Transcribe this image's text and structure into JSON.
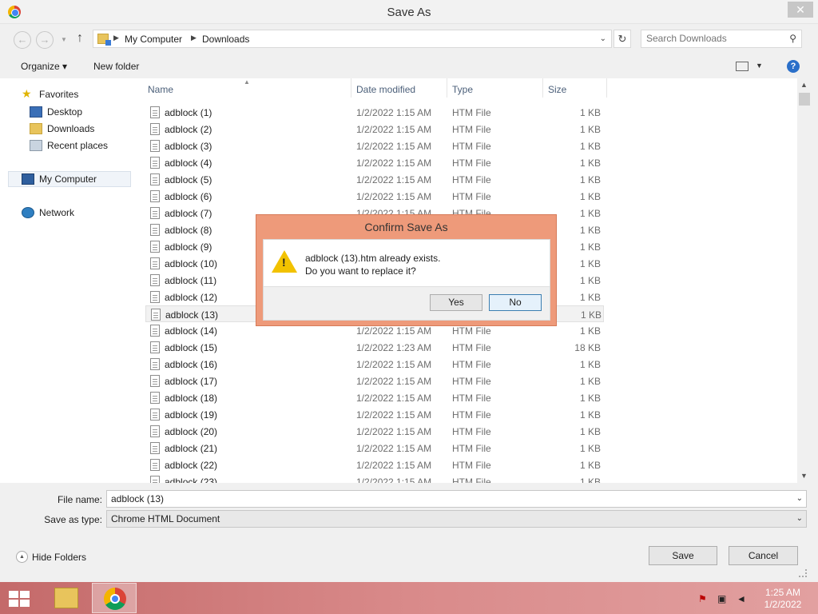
{
  "window": {
    "title": "Save As",
    "close_label": "✕"
  },
  "nav": {
    "back_glyph": "←",
    "forward_glyph": "→",
    "up_glyph": "↑",
    "breadcrumbs": [
      "My Computer",
      "Downloads"
    ],
    "refresh_glyph": "↻",
    "search_placeholder": "Search Downloads"
  },
  "toolbar": {
    "organize": "Organize ▾",
    "new_folder": "New folder",
    "help": "?"
  },
  "sidebar": {
    "favorites": "Favorites",
    "desktop": "Desktop",
    "downloads": "Downloads",
    "recent": "Recent places",
    "my_computer": "My Computer",
    "network": "Network"
  },
  "columns": {
    "name": "Name",
    "date": "Date modified",
    "type": "Type",
    "size": "Size"
  },
  "files": [
    {
      "name": "adblock (1)",
      "date": "1/2/2022 1:15 AM",
      "type": "HTM File",
      "size": "1 KB"
    },
    {
      "name": "adblock (2)",
      "date": "1/2/2022 1:15 AM",
      "type": "HTM File",
      "size": "1 KB"
    },
    {
      "name": "adblock (3)",
      "date": "1/2/2022 1:15 AM",
      "type": "HTM File",
      "size": "1 KB"
    },
    {
      "name": "adblock (4)",
      "date": "1/2/2022 1:15 AM",
      "type": "HTM File",
      "size": "1 KB"
    },
    {
      "name": "adblock (5)",
      "date": "1/2/2022 1:15 AM",
      "type": "HTM File",
      "size": "1 KB"
    },
    {
      "name": "adblock (6)",
      "date": "1/2/2022 1:15 AM",
      "type": "HTM File",
      "size": "1 KB"
    },
    {
      "name": "adblock (7)",
      "date": "1/2/2022 1:15 AM",
      "type": "HTM File",
      "size": "1 KB"
    },
    {
      "name": "adblock (8)",
      "date": "",
      "type": "",
      "size": "1 KB"
    },
    {
      "name": "adblock (9)",
      "date": "",
      "type": "",
      "size": "1 KB"
    },
    {
      "name": "adblock (10)",
      "date": "",
      "type": "",
      "size": "1 KB"
    },
    {
      "name": "adblock (11)",
      "date": "",
      "type": "",
      "size": "1 KB"
    },
    {
      "name": "adblock (12)",
      "date": "",
      "type": "",
      "size": "1 KB"
    },
    {
      "name": "adblock (13)",
      "date": "",
      "type": "",
      "size": "1 KB"
    },
    {
      "name": "adblock (14)",
      "date": "1/2/2022 1:15 AM",
      "type": "HTM File",
      "size": "1 KB"
    },
    {
      "name": "adblock (15)",
      "date": "1/2/2022 1:23 AM",
      "type": "HTM File",
      "size": "18 KB"
    },
    {
      "name": "adblock (16)",
      "date": "1/2/2022 1:15 AM",
      "type": "HTM File",
      "size": "1 KB"
    },
    {
      "name": "adblock (17)",
      "date": "1/2/2022 1:15 AM",
      "type": "HTM File",
      "size": "1 KB"
    },
    {
      "name": "adblock (18)",
      "date": "1/2/2022 1:15 AM",
      "type": "HTM File",
      "size": "1 KB"
    },
    {
      "name": "adblock (19)",
      "date": "1/2/2022 1:15 AM",
      "type": "HTM File",
      "size": "1 KB"
    },
    {
      "name": "adblock (20)",
      "date": "1/2/2022 1:15 AM",
      "type": "HTM File",
      "size": "1 KB"
    },
    {
      "name": "adblock (21)",
      "date": "1/2/2022 1:15 AM",
      "type": "HTM File",
      "size": "1 KB"
    },
    {
      "name": "adblock (22)",
      "date": "1/2/2022 1:15 AM",
      "type": "HTM File",
      "size": "1 KB"
    },
    {
      "name": "adblock (23)",
      "date": "1/2/2022 1:15 AM",
      "type": "HTM File",
      "size": "1 KB"
    }
  ],
  "form": {
    "file_name_label": "File name:",
    "file_name_value": "adblock (13)",
    "save_type_label": "Save as type:",
    "save_type_value": "Chrome HTML Document",
    "hide_folders": "Hide Folders",
    "save": "Save",
    "cancel": "Cancel"
  },
  "dialog": {
    "title": "Confirm Save As",
    "line1": "adblock (13).htm already exists.",
    "line2": "Do you want to replace it?",
    "yes": "Yes",
    "no": "No"
  },
  "taskbar": {
    "time": "1:25 AM",
    "date": "1/2/2022"
  },
  "colors": {
    "dialog_frame": "#ee9a7a",
    "taskbar": "#d98a8a",
    "column_header": "#4c607a",
    "help_blue": "#2a6fc9"
  }
}
